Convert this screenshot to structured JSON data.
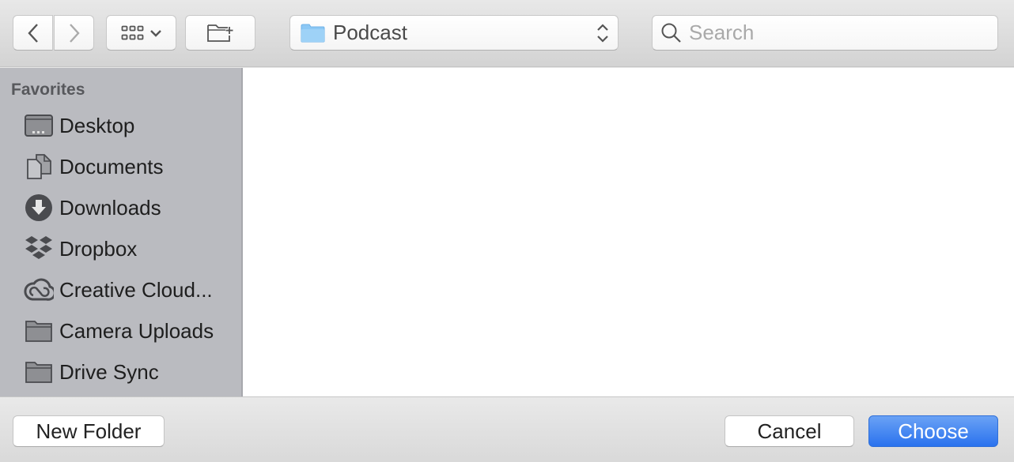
{
  "toolbar": {
    "back_icon": "chevron-left-icon",
    "forward_icon": "chevron-right-icon",
    "view_icon": "icon-grid-view-icon",
    "new_folder_icon": "new-folder-icon",
    "location": {
      "label": "Podcast",
      "icon": "folder-icon",
      "folder_color": "#8cc8f5"
    },
    "search": {
      "placeholder": "Search",
      "value": ""
    }
  },
  "sidebar": {
    "section_title": "Favorites",
    "items": [
      {
        "label": "Desktop",
        "icon": "desktop-icon"
      },
      {
        "label": "Documents",
        "icon": "documents-icon"
      },
      {
        "label": "Downloads",
        "icon": "downloads-icon"
      },
      {
        "label": "Dropbox",
        "icon": "dropbox-icon"
      },
      {
        "label": "Creative Cloud...",
        "icon": "creative-cloud-icon"
      },
      {
        "label": "Camera Uploads",
        "icon": "folder-icon"
      },
      {
        "label": "Drive Sync",
        "icon": "folder-icon"
      }
    ]
  },
  "footer": {
    "new_folder_label": "New Folder",
    "cancel_label": "Cancel",
    "choose_label": "Choose",
    "accent_color": "#2f76ef"
  }
}
